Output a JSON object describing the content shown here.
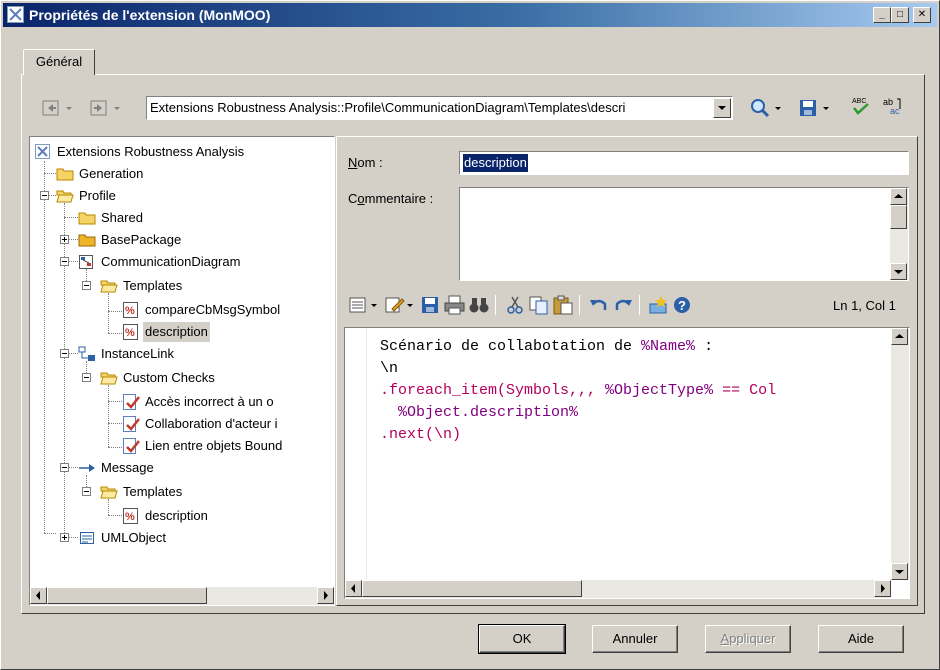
{
  "window": {
    "title": "Propriétés de l'extension (MonMOO)",
    "caption_buttons": {
      "minimize": "_",
      "maximize": "□",
      "close": "✕"
    }
  },
  "tabs": [
    {
      "label": "Général",
      "active": true
    }
  ],
  "navigation": {
    "path": "Extensions Robustness Analysis::Profile\\CommunicationDiagram\\Templates\\descri"
  },
  "tree": {
    "items": [
      {
        "label": "Extensions Robustness Analysis",
        "icon": "extension-icon",
        "level": 0
      },
      {
        "label": "Generation",
        "icon": "folder-icon",
        "level": 1
      },
      {
        "label": "Profile",
        "icon": "folder-open-icon",
        "level": 1,
        "expanded": true
      },
      {
        "label": "Shared",
        "icon": "folder-icon",
        "level": 2
      },
      {
        "label": "BasePackage",
        "icon": "package-folder-icon",
        "level": 2,
        "expandable": true
      },
      {
        "label": "CommunicationDiagram",
        "icon": "diagram-icon",
        "level": 2,
        "expanded": true
      },
      {
        "label": "Templates",
        "icon": "folder-open-icon",
        "level": 3,
        "expanded": true
      },
      {
        "label": "compareCbMsgSymbol",
        "icon": "template-icon",
        "level": 4
      },
      {
        "label": "description",
        "icon": "template-icon",
        "level": 4,
        "selected": true
      },
      {
        "label": "InstanceLink",
        "icon": "instance-link-icon",
        "level": 2,
        "expanded": true
      },
      {
        "label": "Custom Checks",
        "icon": "folder-open-icon",
        "level": 3,
        "expanded": true
      },
      {
        "label": "Accès incorrect à un o",
        "icon": "custom-check-icon",
        "level": 4
      },
      {
        "label": "Collaboration d'acteur i",
        "icon": "custom-check-icon",
        "level": 4
      },
      {
        "label": "Lien entre objets Bound",
        "icon": "custom-check-icon",
        "level": 4
      },
      {
        "label": "Message",
        "icon": "message-icon",
        "level": 2,
        "expanded": true
      },
      {
        "label": "Templates",
        "icon": "folder-open-icon",
        "level": 3,
        "expanded": true
      },
      {
        "label": "description",
        "icon": "template-icon",
        "level": 4
      },
      {
        "label": "UMLObject",
        "icon": "uml-object-icon",
        "level": 2,
        "expandable": true
      }
    ]
  },
  "form": {
    "name_label": "Nom :",
    "name_label_access": "N",
    "name_label_rest": "om :",
    "name_value": "description",
    "comment_label": "Commentaire :",
    "comment_label_pre": "C",
    "comment_label_access": "o",
    "comment_label_rest": "mmentaire :",
    "comment_value": ""
  },
  "editor": {
    "status": "Ln 1, Col 1",
    "lines": [
      [
        {
          "t": "Scénario de collabotation de ",
          "c": "c-text"
        },
        {
          "t": "%Name%",
          "c": "c-var"
        },
        {
          "t": " :",
          "c": "c-text"
        }
      ],
      [
        {
          "t": "\\n",
          "c": "c-text"
        }
      ],
      [
        {
          "t": ".foreach_item(Symbols,,, ",
          "c": "c-macro"
        },
        {
          "t": "%ObjectType%",
          "c": "c-var"
        },
        {
          "t": " == Col",
          "c": "c-macro"
        }
      ],
      [
        {
          "t": "  %Object.description%",
          "c": "c-var"
        }
      ],
      [
        {
          "t": ".next(\\n)",
          "c": "c-macro"
        }
      ]
    ]
  },
  "buttons": {
    "ok": "OK",
    "cancel": "Annuler",
    "apply": "Appliquer",
    "apply_access": "A",
    "apply_rest": "ppliquer",
    "help": "Aide"
  }
}
